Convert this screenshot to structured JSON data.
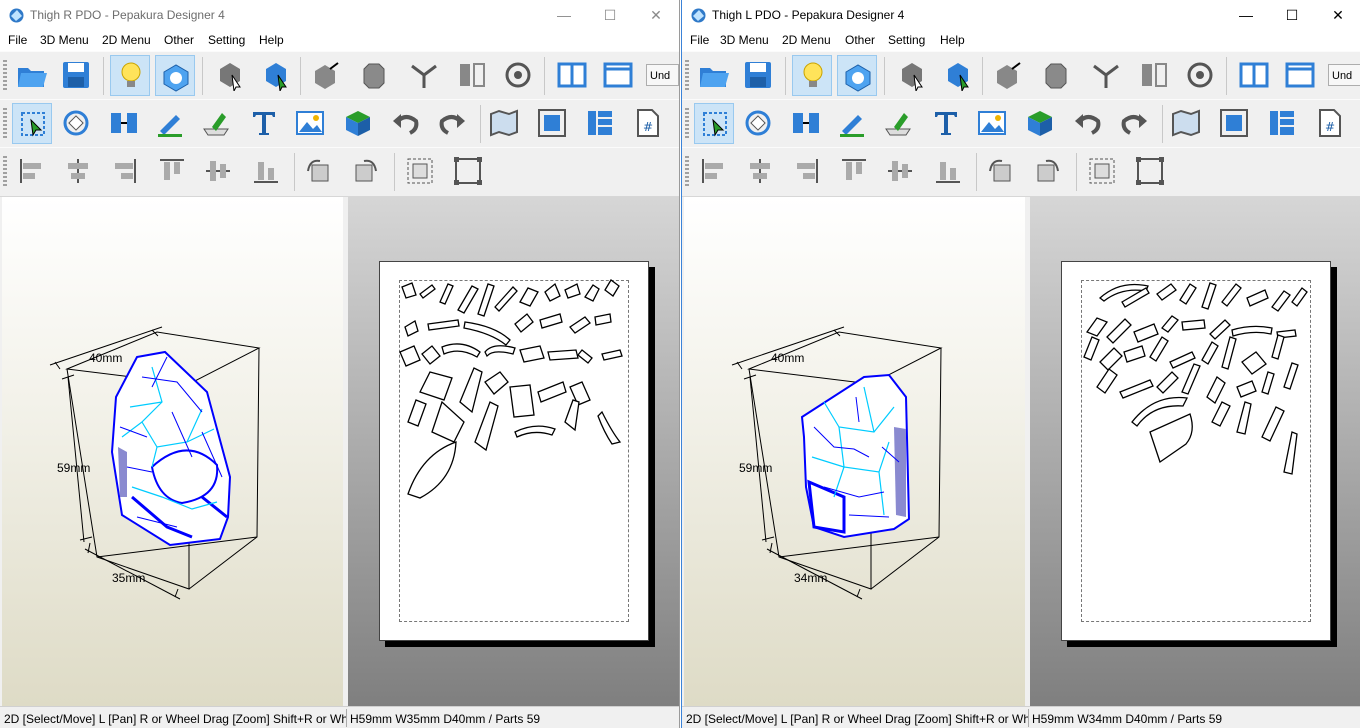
{
  "colors": {
    "accent": "#0000ff",
    "highlight": "#00ccff",
    "active_button": "#cce4f7"
  },
  "window_controls": {
    "minimize": "—",
    "maximize": "☐",
    "close": "✕"
  },
  "menu": [
    "File",
    "3D Menu",
    "2D Menu",
    "Other",
    "Setting",
    "Help"
  ],
  "toolbar": {
    "undo_stub": "Und"
  },
  "windows": [
    {
      "title": "Thigh R PDO - Pepakura Designer 4",
      "dims": {
        "depth": "40mm",
        "height": "59mm",
        "width": "35mm"
      },
      "status": {
        "left": "2D [Select/Move] L [Pan] R or Wheel Drag [Zoom] Shift+R or Whe",
        "right": "H59mm W35mm D40mm / Parts 59"
      }
    },
    {
      "title": "Thigh L PDO - Pepakura Designer 4",
      "dims": {
        "depth": "40mm",
        "height": "59mm",
        "width": "34mm"
      },
      "status": {
        "left": "2D [Select/Move] L [Pan] R or Wheel Drag [Zoom] Shift+R or Whe",
        "right": "H59mm W34mm D40mm / Parts 59"
      }
    }
  ],
  "icons": {
    "row1": [
      "open-file-icon",
      "save-icon",
      "light-bulb-icon",
      "texture-toggle-icon",
      "select-3d-icon",
      "select-face-icon",
      "edge-tool-icon",
      "box-prism-icon",
      "join-edges-icon",
      "mirror-icon",
      "view-eye-icon",
      "single-pane-icon",
      "split-pane-icon"
    ],
    "row2": [
      "select-move-icon",
      "rotate-part-icon",
      "join-parts-icon",
      "edit-line-icon",
      "flap-icon",
      "text-icon",
      "image-icon",
      "colored-box-icon",
      "undo-icon",
      "redo-icon",
      "unfold-map-icon",
      "fit-page-icon",
      "layout-grid-icon",
      "page-number-icon"
    ],
    "row3": [
      "align-left-icon",
      "align-center-icon",
      "align-right-icon",
      "align-top-icon",
      "align-middle-icon",
      "align-bottom-icon",
      "rotate-left-icon",
      "rotate-right-icon",
      "group-icon",
      "ungroup-icon"
    ]
  }
}
